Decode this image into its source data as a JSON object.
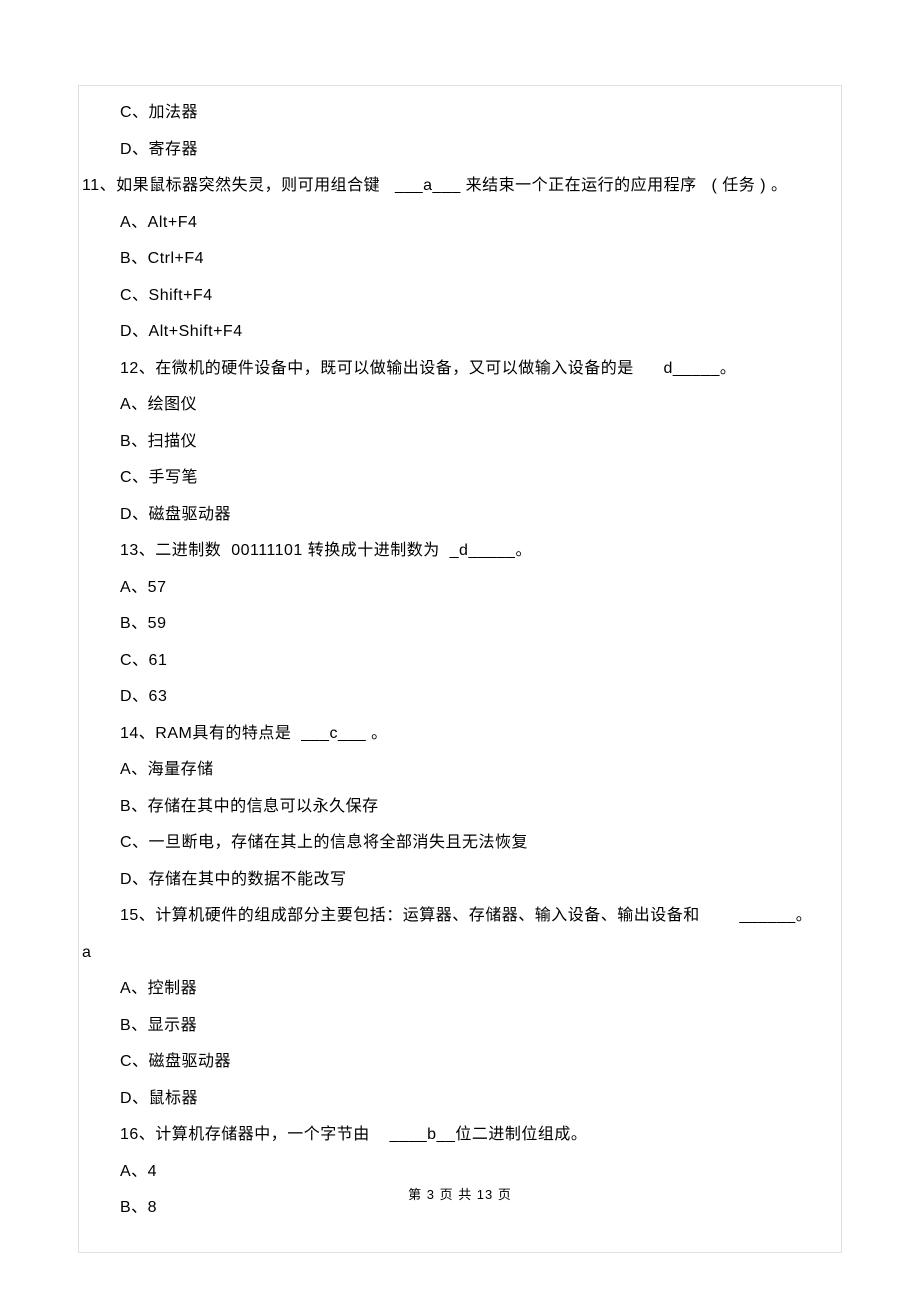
{
  "lines": [
    {
      "indent": "indent1",
      "text": "C、加法器"
    },
    {
      "indent": "indent1",
      "text": "D、寄存器"
    },
    {
      "indent": "indent0",
      "text": "11、如果鼠标器突然失灵，则可用组合键   ___a___ 来结束一个正在运行的应用程序   ( 任务 ) 。"
    },
    {
      "indent": "indent1",
      "text": "A、Alt+F4"
    },
    {
      "indent": "indent1",
      "text": "B、Ctrl+F4"
    },
    {
      "indent": "indent1",
      "text": "C、Shift+F4"
    },
    {
      "indent": "indent1",
      "text": "D、Alt+Shift+F4"
    },
    {
      "indent": "indent1",
      "text": "12、在微机的硬件设备中，既可以做输出设备，又可以做输入设备的是      d_____。"
    },
    {
      "indent": "indent1",
      "text": "A、绘图仪"
    },
    {
      "indent": "indent1",
      "text": "B、扫描仪"
    },
    {
      "indent": "indent1",
      "text": "C、手写笔"
    },
    {
      "indent": "indent1",
      "text": "D、磁盘驱动器"
    },
    {
      "indent": "indent1",
      "text": "13、二进制数  00111101 转换成十进制数为  _d_____。"
    },
    {
      "indent": "indent1",
      "text": "A、57"
    },
    {
      "indent": "indent1",
      "text": "B、59"
    },
    {
      "indent": "indent1",
      "text": "C、61"
    },
    {
      "indent": "indent1",
      "text": "D、63"
    },
    {
      "indent": "indent1",
      "text": "14、RAM具有的特点是  ___c___ 。"
    },
    {
      "indent": "indent1",
      "text": "A、海量存储"
    },
    {
      "indent": "indent1",
      "text": "B、存储在其中的信息可以永久保存"
    },
    {
      "indent": "indent1",
      "text": "C、一旦断电，存储在其上的信息将全部消失且无法恢复"
    },
    {
      "indent": "indent1",
      "text": "D、存储在其中的数据不能改写"
    },
    {
      "indent": "indent1",
      "text": "15、计算机硬件的组成部分主要包括：运算器、存储器、输入设备、输出设备和        ______。"
    },
    {
      "indent": "indent0",
      "text": "a"
    },
    {
      "indent": "indent1",
      "text": "A、控制器"
    },
    {
      "indent": "indent1",
      "text": "B、显示器"
    },
    {
      "indent": "indent1",
      "text": "C、磁盘驱动器"
    },
    {
      "indent": "indent1",
      "text": "D、鼠标器"
    },
    {
      "indent": "indent1",
      "text": "16、计算机存储器中，一个字节由    ____b__位二进制位组成。"
    },
    {
      "indent": "indent1",
      "text": "A、4"
    },
    {
      "indent": "indent1",
      "text": "B、8"
    }
  ],
  "footer": "第 3 页 共 13 页"
}
